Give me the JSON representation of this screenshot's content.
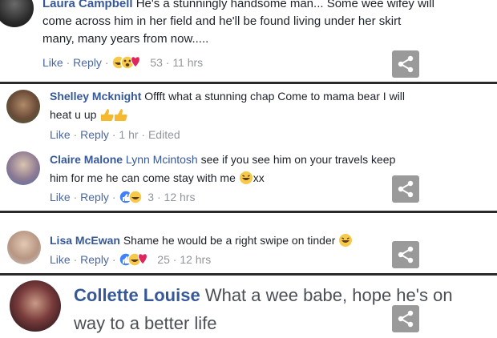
{
  "comments": [
    {
      "name": "Laura Campbell",
      "text_line1": "He's a stunningly handsome man... Some wee wifey will",
      "text_line2": "come across him in her field and he'll be found living under her skirt",
      "text_line3": "many, many years from now.....",
      "like": "Like",
      "reply": "Reply",
      "reaction_count": "53",
      "time": "11 hrs",
      "avatar_icon": "person-avatar-icon"
    },
    {
      "name": "Shelley Mcknight",
      "text_line1": "Offft what a stunning chap Come to mama bear I will",
      "text_line2": "heat u up",
      "like": "Like",
      "reply": "Reply",
      "time": "1 hr",
      "edited": "Edited",
      "emoji": "thumbs-up-emoji"
    },
    {
      "name": "Claire Malone",
      "mention": "Lynn Mcintosh",
      "text_line1": "see if you see him on your travels keep",
      "text_line2": "him for me he can come stay with me",
      "text_suffix": "xx",
      "like": "Like",
      "reply": "Reply",
      "reaction_count": "3",
      "time": "12 hrs"
    },
    {
      "name": "Lisa McEwan",
      "text_line1": "Shame he would be a right swipe on tinder",
      "like": "Like",
      "reply": "Reply",
      "reaction_count": "25",
      "time": "12 hrs"
    },
    {
      "name": "Collette Louise",
      "text_line1": "What a wee babe, hope he's on",
      "text_line2": "way to a better life"
    }
  ],
  "separator": " · ",
  "share_icon": "share-icon",
  "colors": {
    "name": "#365899",
    "meta": "#90949c",
    "link": "#4b67a1",
    "share_bg": "#9a9a9a",
    "divider": "#2a2a2a"
  }
}
